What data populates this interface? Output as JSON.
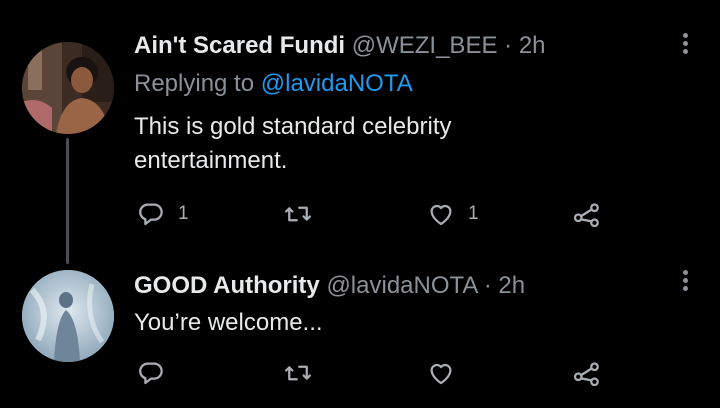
{
  "tweets": [
    {
      "display_name": "Ain't Scared Fundi",
      "handle": "@WEZI_BEE",
      "separator": "·",
      "time": "2h",
      "replying_prefix": "Replying to",
      "replying_to": "@lavidaNOTA",
      "text": "This is gold standard celebrity entertainment.",
      "reply_count": "1",
      "retweet_count": "",
      "like_count": "1"
    },
    {
      "display_name": "GOOD Authority",
      "handle": "@lavidaNOTA",
      "separator": "·",
      "time": "2h",
      "text": "You’re welcome...",
      "reply_count": "",
      "retweet_count": "",
      "like_count": ""
    }
  ],
  "icons": {
    "reply": "reply-icon",
    "retweet": "retweet-icon",
    "like": "like-icon",
    "share": "share-icon",
    "more": "more-icon"
  },
  "colors": {
    "background": "#000000",
    "text": "#e7e9ea",
    "secondary": "#8b9198",
    "link": "#1d9bf0"
  }
}
